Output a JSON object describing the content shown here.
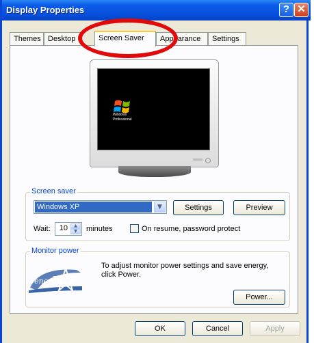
{
  "window": {
    "title": "Display Properties",
    "help_label": "?",
    "close_label": "✕"
  },
  "tabs": [
    {
      "label": "Themes",
      "active": false
    },
    {
      "label": "Desktop",
      "active": false
    },
    {
      "label": "Screen Saver",
      "active": true
    },
    {
      "label": "Appearance",
      "active": false
    },
    {
      "label": "Settings",
      "active": false
    }
  ],
  "preview": {
    "logo_text": "Windows",
    "logo_sub": "Professional"
  },
  "screen_saver": {
    "group_label": "Screen saver",
    "selected": "Windows XP",
    "settings_label": "Settings",
    "preview_label": "Preview",
    "wait_label": "Wait:",
    "wait_value": "10",
    "minutes_label": "minutes",
    "password_label": "On resume, password protect"
  },
  "monitor_power": {
    "group_label": "Monitor power",
    "description_line1": "To adjust monitor power settings and save energy,",
    "description_line2": "click Power.",
    "power_label": "Power..."
  },
  "dialog_buttons": {
    "ok_label": "OK",
    "cancel_label": "Cancel",
    "apply_label": "Apply"
  },
  "colors": {
    "titlebar": "#0b5ce8",
    "group_label": "#0046d5",
    "selection": "#316ac5",
    "annotation": "#e00a0a"
  }
}
